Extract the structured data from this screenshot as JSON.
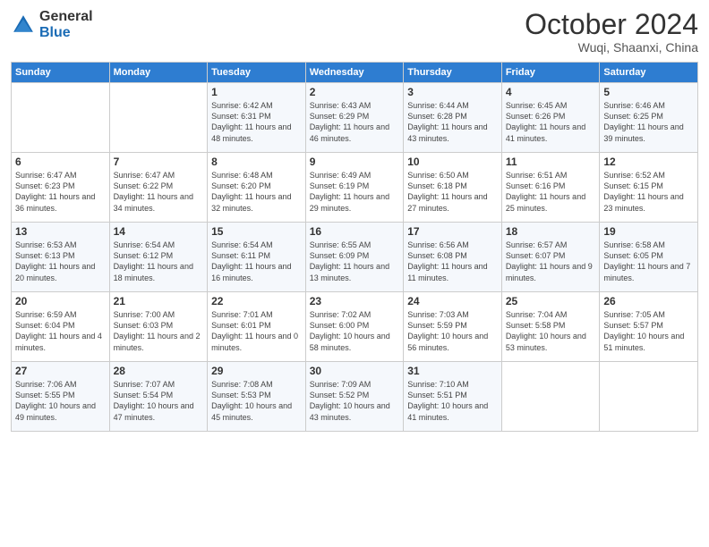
{
  "header": {
    "logo_general": "General",
    "logo_blue": "Blue",
    "title": "October 2024",
    "location": "Wuqi, Shaanxi, China"
  },
  "days_of_week": [
    "Sunday",
    "Monday",
    "Tuesday",
    "Wednesday",
    "Thursday",
    "Friday",
    "Saturday"
  ],
  "weeks": [
    [
      {
        "day": "",
        "sunrise": "",
        "sunset": "",
        "daylight": ""
      },
      {
        "day": "",
        "sunrise": "",
        "sunset": "",
        "daylight": ""
      },
      {
        "day": "1",
        "sunrise": "Sunrise: 6:42 AM",
        "sunset": "Sunset: 6:31 PM",
        "daylight": "Daylight: 11 hours and 48 minutes."
      },
      {
        "day": "2",
        "sunrise": "Sunrise: 6:43 AM",
        "sunset": "Sunset: 6:29 PM",
        "daylight": "Daylight: 11 hours and 46 minutes."
      },
      {
        "day": "3",
        "sunrise": "Sunrise: 6:44 AM",
        "sunset": "Sunset: 6:28 PM",
        "daylight": "Daylight: 11 hours and 43 minutes."
      },
      {
        "day": "4",
        "sunrise": "Sunrise: 6:45 AM",
        "sunset": "Sunset: 6:26 PM",
        "daylight": "Daylight: 11 hours and 41 minutes."
      },
      {
        "day": "5",
        "sunrise": "Sunrise: 6:46 AM",
        "sunset": "Sunset: 6:25 PM",
        "daylight": "Daylight: 11 hours and 39 minutes."
      }
    ],
    [
      {
        "day": "6",
        "sunrise": "Sunrise: 6:47 AM",
        "sunset": "Sunset: 6:23 PM",
        "daylight": "Daylight: 11 hours and 36 minutes."
      },
      {
        "day": "7",
        "sunrise": "Sunrise: 6:47 AM",
        "sunset": "Sunset: 6:22 PM",
        "daylight": "Daylight: 11 hours and 34 minutes."
      },
      {
        "day": "8",
        "sunrise": "Sunrise: 6:48 AM",
        "sunset": "Sunset: 6:20 PM",
        "daylight": "Daylight: 11 hours and 32 minutes."
      },
      {
        "day": "9",
        "sunrise": "Sunrise: 6:49 AM",
        "sunset": "Sunset: 6:19 PM",
        "daylight": "Daylight: 11 hours and 29 minutes."
      },
      {
        "day": "10",
        "sunrise": "Sunrise: 6:50 AM",
        "sunset": "Sunset: 6:18 PM",
        "daylight": "Daylight: 11 hours and 27 minutes."
      },
      {
        "day": "11",
        "sunrise": "Sunrise: 6:51 AM",
        "sunset": "Sunset: 6:16 PM",
        "daylight": "Daylight: 11 hours and 25 minutes."
      },
      {
        "day": "12",
        "sunrise": "Sunrise: 6:52 AM",
        "sunset": "Sunset: 6:15 PM",
        "daylight": "Daylight: 11 hours and 23 minutes."
      }
    ],
    [
      {
        "day": "13",
        "sunrise": "Sunrise: 6:53 AM",
        "sunset": "Sunset: 6:13 PM",
        "daylight": "Daylight: 11 hours and 20 minutes."
      },
      {
        "day": "14",
        "sunrise": "Sunrise: 6:54 AM",
        "sunset": "Sunset: 6:12 PM",
        "daylight": "Daylight: 11 hours and 18 minutes."
      },
      {
        "day": "15",
        "sunrise": "Sunrise: 6:54 AM",
        "sunset": "Sunset: 6:11 PM",
        "daylight": "Daylight: 11 hours and 16 minutes."
      },
      {
        "day": "16",
        "sunrise": "Sunrise: 6:55 AM",
        "sunset": "Sunset: 6:09 PM",
        "daylight": "Daylight: 11 hours and 13 minutes."
      },
      {
        "day": "17",
        "sunrise": "Sunrise: 6:56 AM",
        "sunset": "Sunset: 6:08 PM",
        "daylight": "Daylight: 11 hours and 11 minutes."
      },
      {
        "day": "18",
        "sunrise": "Sunrise: 6:57 AM",
        "sunset": "Sunset: 6:07 PM",
        "daylight": "Daylight: 11 hours and 9 minutes."
      },
      {
        "day": "19",
        "sunrise": "Sunrise: 6:58 AM",
        "sunset": "Sunset: 6:05 PM",
        "daylight": "Daylight: 11 hours and 7 minutes."
      }
    ],
    [
      {
        "day": "20",
        "sunrise": "Sunrise: 6:59 AM",
        "sunset": "Sunset: 6:04 PM",
        "daylight": "Daylight: 11 hours and 4 minutes."
      },
      {
        "day": "21",
        "sunrise": "Sunrise: 7:00 AM",
        "sunset": "Sunset: 6:03 PM",
        "daylight": "Daylight: 11 hours and 2 minutes."
      },
      {
        "day": "22",
        "sunrise": "Sunrise: 7:01 AM",
        "sunset": "Sunset: 6:01 PM",
        "daylight": "Daylight: 11 hours and 0 minutes."
      },
      {
        "day": "23",
        "sunrise": "Sunrise: 7:02 AM",
        "sunset": "Sunset: 6:00 PM",
        "daylight": "Daylight: 10 hours and 58 minutes."
      },
      {
        "day": "24",
        "sunrise": "Sunrise: 7:03 AM",
        "sunset": "Sunset: 5:59 PM",
        "daylight": "Daylight: 10 hours and 56 minutes."
      },
      {
        "day": "25",
        "sunrise": "Sunrise: 7:04 AM",
        "sunset": "Sunset: 5:58 PM",
        "daylight": "Daylight: 10 hours and 53 minutes."
      },
      {
        "day": "26",
        "sunrise": "Sunrise: 7:05 AM",
        "sunset": "Sunset: 5:57 PM",
        "daylight": "Daylight: 10 hours and 51 minutes."
      }
    ],
    [
      {
        "day": "27",
        "sunrise": "Sunrise: 7:06 AM",
        "sunset": "Sunset: 5:55 PM",
        "daylight": "Daylight: 10 hours and 49 minutes."
      },
      {
        "day": "28",
        "sunrise": "Sunrise: 7:07 AM",
        "sunset": "Sunset: 5:54 PM",
        "daylight": "Daylight: 10 hours and 47 minutes."
      },
      {
        "day": "29",
        "sunrise": "Sunrise: 7:08 AM",
        "sunset": "Sunset: 5:53 PM",
        "daylight": "Daylight: 10 hours and 45 minutes."
      },
      {
        "day": "30",
        "sunrise": "Sunrise: 7:09 AM",
        "sunset": "Sunset: 5:52 PM",
        "daylight": "Daylight: 10 hours and 43 minutes."
      },
      {
        "day": "31",
        "sunrise": "Sunrise: 7:10 AM",
        "sunset": "Sunset: 5:51 PM",
        "daylight": "Daylight: 10 hours and 41 minutes."
      },
      {
        "day": "",
        "sunrise": "",
        "sunset": "",
        "daylight": ""
      },
      {
        "day": "",
        "sunrise": "",
        "sunset": "",
        "daylight": ""
      }
    ]
  ]
}
